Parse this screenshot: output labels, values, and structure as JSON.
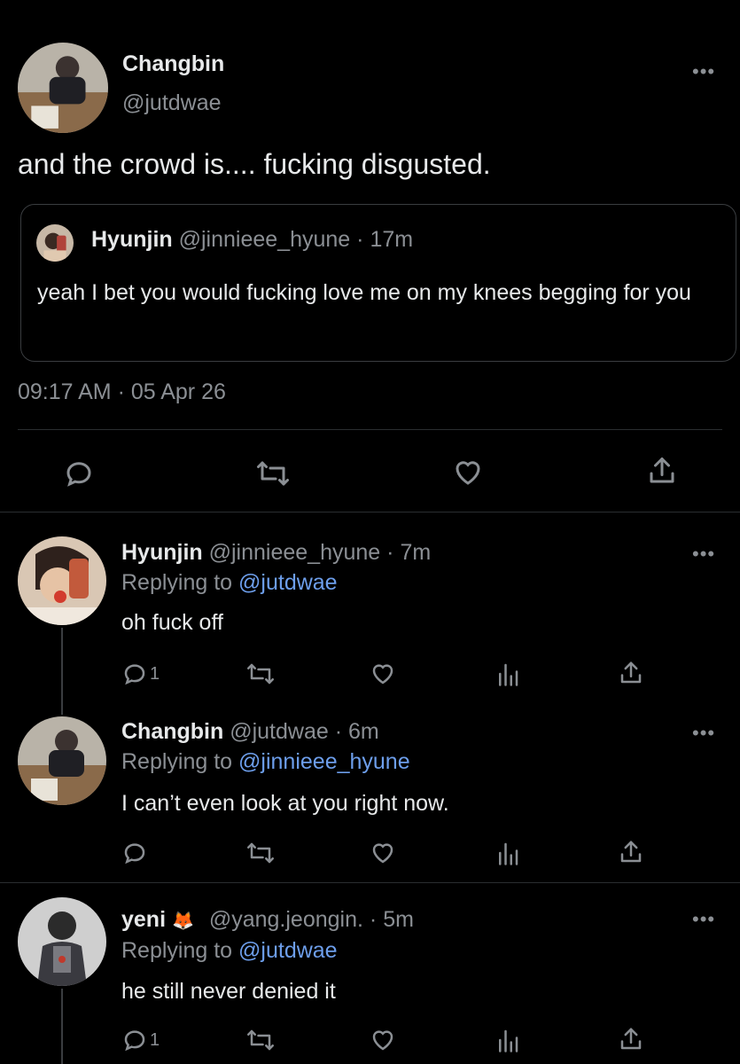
{
  "main_tweet": {
    "author_name": "Changbin",
    "author_handle": "@jutdwae",
    "text": "and the crowd is.... fucking disgusted.",
    "quote": {
      "author_name": "Hyunjin",
      "author_handle": "@jinnieee_hyune",
      "separator": "·",
      "time": "17m",
      "text": "yeah I bet you would fucking love me on my knees begging for you"
    },
    "timestamp": "09:17 AM · 05 Apr 26",
    "more_label": "•••"
  },
  "replies": [
    {
      "author_name": "Hyunjin",
      "author_handle": "@jinnieee_hyune",
      "separator": "·",
      "time": "7m",
      "replying_prefix": "Replying to",
      "replying_handle": "@jutdwae",
      "text": "oh fuck off",
      "reply_count": "1",
      "more_label": "•••"
    },
    {
      "author_name": "Changbin",
      "author_handle": "@jutdwae",
      "separator": "·",
      "time": "6m",
      "replying_prefix": "Replying to",
      "replying_handle": "@jinnieee_hyune",
      "text": "I can’t even look at you right now.",
      "reply_count": "",
      "more_label": "•••"
    },
    {
      "author_name": "yeni",
      "author_emoji": "🦊",
      "author_handle": "@yang.jeongin.",
      "separator": "·",
      "time": "5m",
      "replying_prefix": "Replying to",
      "replying_handle": "@jutdwae",
      "text": "he still never denied it",
      "reply_count": "1",
      "more_label": "•••"
    }
  ],
  "icons": [
    "reply-icon",
    "retweet-icon",
    "like-icon",
    "views-icon",
    "share-icon",
    "more-icon"
  ],
  "colors": {
    "background": "#000000",
    "text": "#e7e9ea",
    "secondary": "#8b8f94",
    "link": "#6d9eeb",
    "border": "#2a2d30"
  }
}
